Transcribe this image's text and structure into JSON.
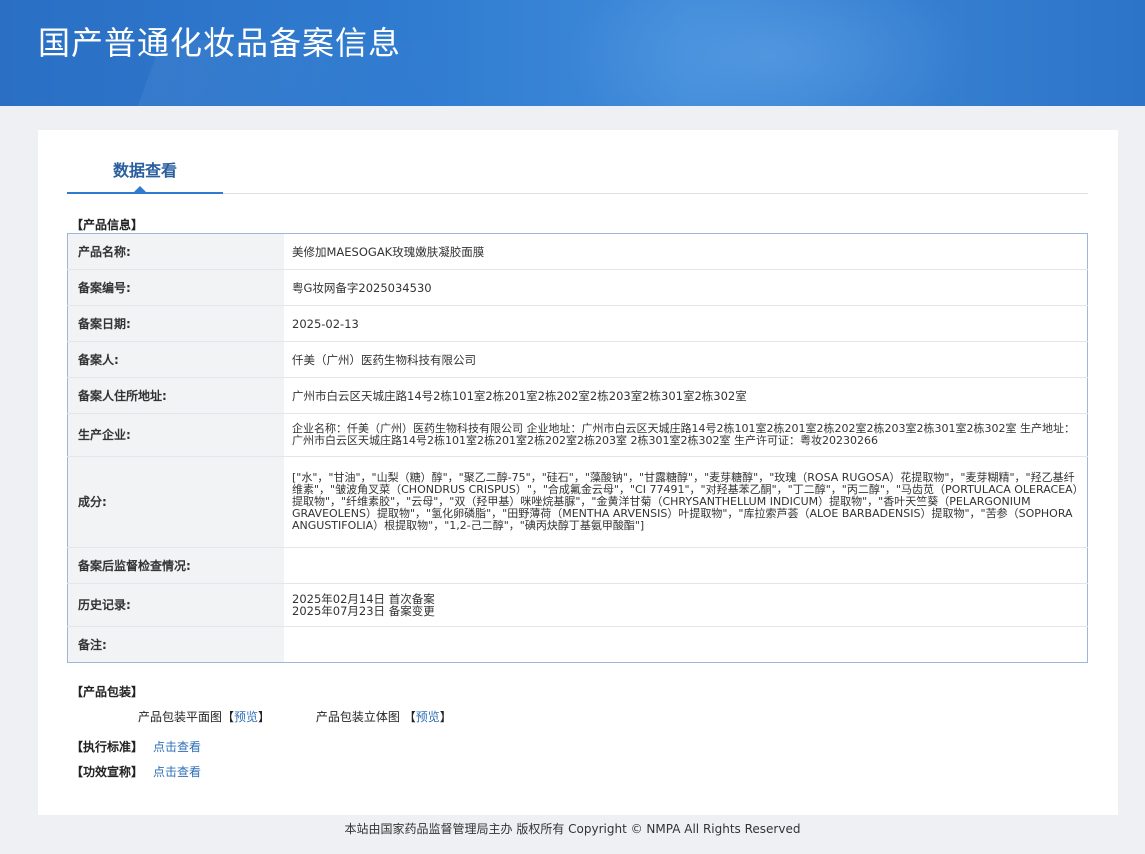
{
  "header": {
    "title": "国产普通化妆品备案信息"
  },
  "tabs": [
    {
      "label": "数据查看"
    }
  ],
  "product_info": {
    "section_title": "【产品信息】",
    "rows": [
      {
        "label": "产品名称:",
        "value": "美修加MAESOGAK玫瑰嫩肤凝胶面膜"
      },
      {
        "label": "备案编号:",
        "value": "粤G妆网备字2025034530"
      },
      {
        "label": "备案日期:",
        "value": "2025-02-13"
      },
      {
        "label": "备案人:",
        "value": "仟美（广州）医药生物科技有限公司"
      },
      {
        "label": "备案人住所地址:",
        "value": "广州市白云区天城庄路14号2栋101室2栋201室2栋202室2栋203室2栋301室2栋302室"
      },
      {
        "label": "生产企业:",
        "value": "企业名称：仟美（广州）医药生物科技有限公司 企业地址：广州市白云区天城庄路14号2栋101室2栋201室2栋202室2栋203室2栋301室2栋302室 生产地址：广州市白云区天城庄路14号2栋101室2栋201室2栋202室2栋203室 2栋301室2栋302室 生产许可证：粤妆20230266"
      },
      {
        "label": "成分:",
        "value": "[\"水\"，\"甘油\"，\"山梨（糖）醇\"，\"聚乙二醇-75\"，\"硅石\"，\"藻酸钠\"，\"甘露糖醇\"，\"麦芽糖醇\"，\"玫瑰（ROSA RUGOSA）花提取物\"，\"麦芽糊精\"，\"羟乙基纤维素\"，\"皱波角叉菜（CHONDRUS CRISPUS）\"，\"合成氟金云母\"，\"CI 77491\"，\"对羟基苯乙酮\"，\"丁二醇\"，\"丙二醇\"，\"马齿苋（PORTULACA OLERACEA）提取物\"，\"纤维素胶\"，\"云母\"，\"双（羟甲基）咪唑烷基脲\"，\"金黄洋甘菊（CHRYSANTHELLUM INDICUM）提取物\"，\"香叶天竺葵（PELARGONIUM GRAVEOLENS）提取物\"，\"氢化卵磷脂\"，\"田野薄荷（MENTHA ARVENSIS）叶提取物\"，\"库拉索芦荟（ALOE BARBADENSIS）提取物\"，\"苦参（SOPHORA ANGUSTIFOLIA）根提取物\"，\"1,2-己二醇\"，\"碘丙炔醇丁基氨甲酸酯\"]"
      },
      {
        "label": "备案后监督检查情况:",
        "value": ""
      },
      {
        "label": "历史记录:",
        "value": "",
        "lines": [
          "2025年02月14日 首次备案",
          "2025年07月23日 备案变更"
        ]
      },
      {
        "label": "备注:",
        "value": ""
      }
    ]
  },
  "packaging": {
    "section_title": "【产品包装】",
    "items": [
      {
        "label": "产品包装平面图",
        "link": "预览"
      },
      {
        "label": "产品包装立体图",
        "link": "预览"
      }
    ]
  },
  "standard": {
    "label": "【执行标准】",
    "link": "点击查看"
  },
  "efficacy": {
    "label": "【功效宣称】",
    "link": "点击查看"
  },
  "footer": {
    "text": "本站由国家药品监督管理局主办 版权所有 Copyright © NMPA All Rights Reserved"
  }
}
